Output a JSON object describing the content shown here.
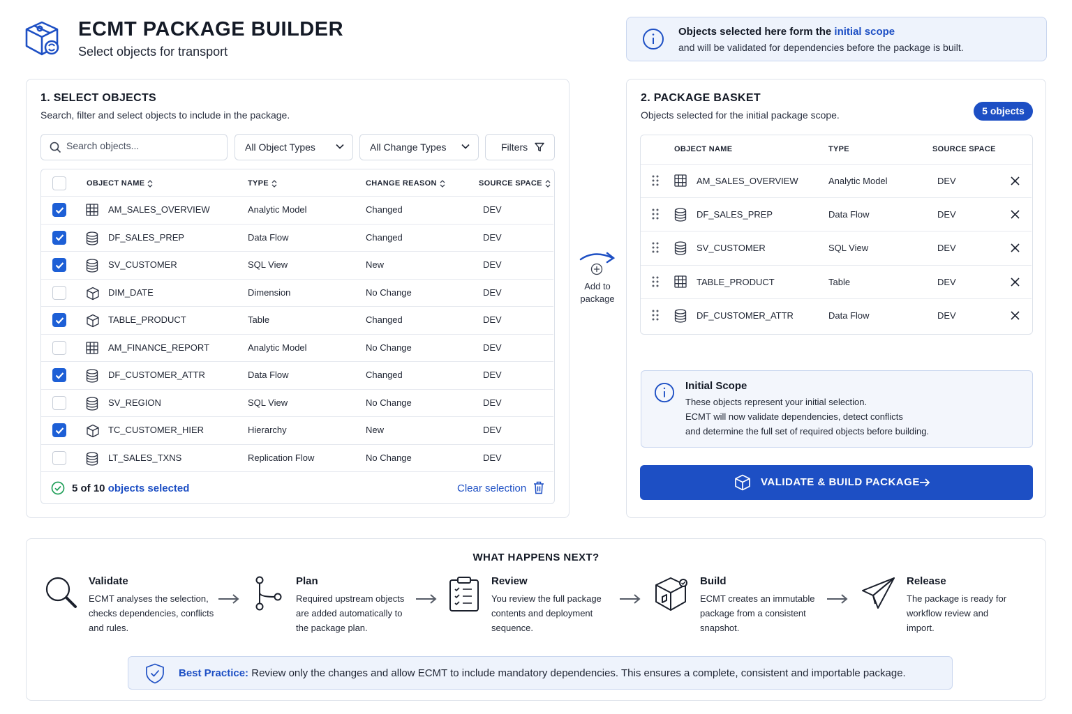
{
  "header": {
    "title": "ECMT PACKAGE BUILDER",
    "subtitle": "Select objects for transport",
    "logo_icon": "package-icon"
  },
  "banner": {
    "line1_pre": "Objects selected here form the ",
    "line1_link": "initial scope",
    "line2": "and will be validated for dependencies before the package is built."
  },
  "select_panel": {
    "title": "1. SELECT OBJECTS",
    "subtitle": "Search, filter and select objects to include in the package.",
    "search_placeholder": "Search objects...",
    "object_type_filter": "All Object Types",
    "change_type_filter": "All Change Types",
    "filters_label": "Filters",
    "columns": [
      "OBJECT NAME",
      "TYPE",
      "CHANGE REASON",
      "SOURCE SPACE"
    ],
    "rows": [
      {
        "name": "AM_SALES_OVERVIEW",
        "type": "Analytic Model",
        "reason": "Changed",
        "space": "DEV",
        "checked": true,
        "icon": "grid-icon"
      },
      {
        "name": "DF_SALES_PREP",
        "type": "Data Flow",
        "reason": "Changed",
        "space": "DEV",
        "checked": true,
        "icon": "database-icon"
      },
      {
        "name": "SV_CUSTOMER",
        "type": "SQL View",
        "reason": "New",
        "space": "DEV",
        "checked": true,
        "icon": "database-icon"
      },
      {
        "name": "DIM_DATE",
        "type": "Dimension",
        "reason": "No Change",
        "space": "DEV",
        "checked": false,
        "icon": "cube-icon"
      },
      {
        "name": "TABLE_PRODUCT",
        "type": "Table",
        "reason": "Changed",
        "space": "DEV",
        "checked": true,
        "icon": "cube-icon"
      },
      {
        "name": "AM_FINANCE_REPORT",
        "type": "Analytic Model",
        "reason": "No Change",
        "space": "DEV",
        "checked": false,
        "icon": "grid-icon"
      },
      {
        "name": "DF_CUSTOMER_ATTR",
        "type": "Data Flow",
        "reason": "Changed",
        "space": "DEV",
        "checked": true,
        "icon": "database-icon"
      },
      {
        "name": "SV_REGION",
        "type": "SQL View",
        "reason": "No Change",
        "space": "DEV",
        "checked": false,
        "icon": "database-icon"
      },
      {
        "name": "TC_CUSTOMER_HIER",
        "type": "Hierarchy",
        "reason": "New",
        "space": "DEV",
        "checked": true,
        "icon": "cube-icon"
      },
      {
        "name": "LT_SALES_TXNS",
        "type": "Replication Flow",
        "reason": "No Change",
        "space": "DEV",
        "checked": false,
        "icon": "database-icon"
      }
    ],
    "selection_count": "5 of 10",
    "selection_suffix": " objects selected",
    "clear_label": "Clear selection"
  },
  "add_to_package": {
    "line1": "Add to",
    "line2": "package"
  },
  "basket_panel": {
    "title": "2. PACKAGE BASKET",
    "subtitle": "Objects selected for the initial package scope.",
    "badge": "5 objects",
    "columns": [
      "OBJECT NAME",
      "TYPE",
      "SOURCE SPACE"
    ],
    "rows": [
      {
        "name": "AM_SALES_OVERVIEW",
        "type": "Analytic Model",
        "space": "DEV",
        "icon": "grid-icon"
      },
      {
        "name": "DF_SALES_PREP",
        "type": "Data Flow",
        "space": "DEV",
        "icon": "database-icon"
      },
      {
        "name": "SV_CUSTOMER",
        "type": "SQL View",
        "space": "DEV",
        "icon": "database-icon"
      },
      {
        "name": "TABLE_PRODUCT",
        "type": "Table",
        "space": "DEV",
        "icon": "grid-icon"
      },
      {
        "name": "DF_CUSTOMER_ATTR",
        "type": "Data Flow",
        "space": "DEV",
        "icon": "database-icon"
      }
    ],
    "scope_title": "Initial Scope",
    "scope_line1": "These objects represent your initial selection.",
    "scope_line2": "ECMT will now validate dependencies, detect conflicts",
    "scope_line3": "and determine the full set of required objects before building.",
    "cta_label": "VALIDATE & BUILD PACKAGE"
  },
  "next_steps": {
    "title": "WHAT HAPPENS NEXT?",
    "steps": [
      {
        "name": "Validate",
        "desc": "ECMT analyses the selection, checks dependencies, conflicts and rules.",
        "icon": "magnifier-icon"
      },
      {
        "name": "Plan",
        "desc": "Required upstream objects are added automatically to the package plan.",
        "icon": "branch-icon"
      },
      {
        "name": "Review",
        "desc": "You review the full package contents and deployment sequence.",
        "icon": "clipboard-icon"
      },
      {
        "name": "Build",
        "desc": "ECMT creates an immutable package from a consistent snapshot.",
        "icon": "box-icon"
      },
      {
        "name": "Release",
        "desc": "The package is ready for workflow review and import.",
        "icon": "paper-plane-icon"
      }
    ],
    "tip_label": "Best Practice:",
    "tip_text": " Review only the changes and allow ECMT to include mandatory dependencies. This ensures a complete, consistent and importable package."
  },
  "colors": {
    "accent": "#1d4fc4",
    "checkbox": "#1d5fd6",
    "success": "#22a05a"
  }
}
